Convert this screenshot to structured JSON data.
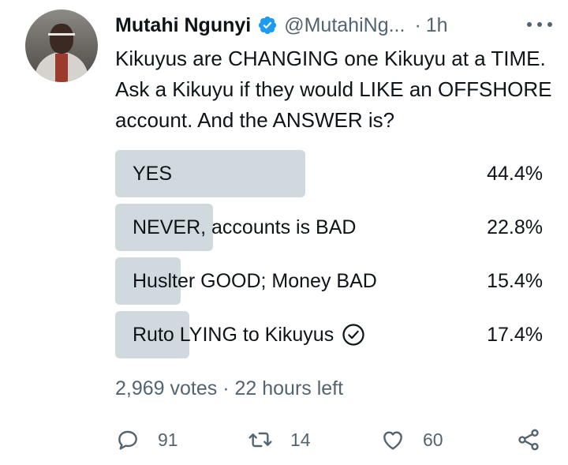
{
  "tweet": {
    "author_name": "Mutahi Ngunyi",
    "handle": "@MutahiNg...",
    "separator": "·",
    "time": "1h",
    "text": "Kikuyus are CHANGING one Kikuyu at a TIME. Ask a Kikuyu if they would LIKE an OFFSHORE account. And the ANSWER is?"
  },
  "poll": {
    "options": [
      {
        "label": "YES",
        "percent_text": "44.4%",
        "percent": 44.4,
        "selected": false
      },
      {
        "label": "NEVER, accounts is BAD",
        "percent_text": "22.8%",
        "percent": 22.8,
        "selected": false
      },
      {
        "label": "Huslter GOOD; Money BAD",
        "percent_text": "15.4%",
        "percent": 15.4,
        "selected": false
      },
      {
        "label": "Ruto LYING to Kikuyus",
        "percent_text": "17.4%",
        "percent": 17.4,
        "selected": true
      }
    ],
    "meta": "2,969 votes · 22 hours left"
  },
  "actions": {
    "reply_count": "91",
    "retweet_count": "14",
    "like_count": "60"
  },
  "colors": {
    "bar": "#cfd9de",
    "verified": "#1d9bf0",
    "muted": "#536471",
    "text": "#0f1419"
  }
}
